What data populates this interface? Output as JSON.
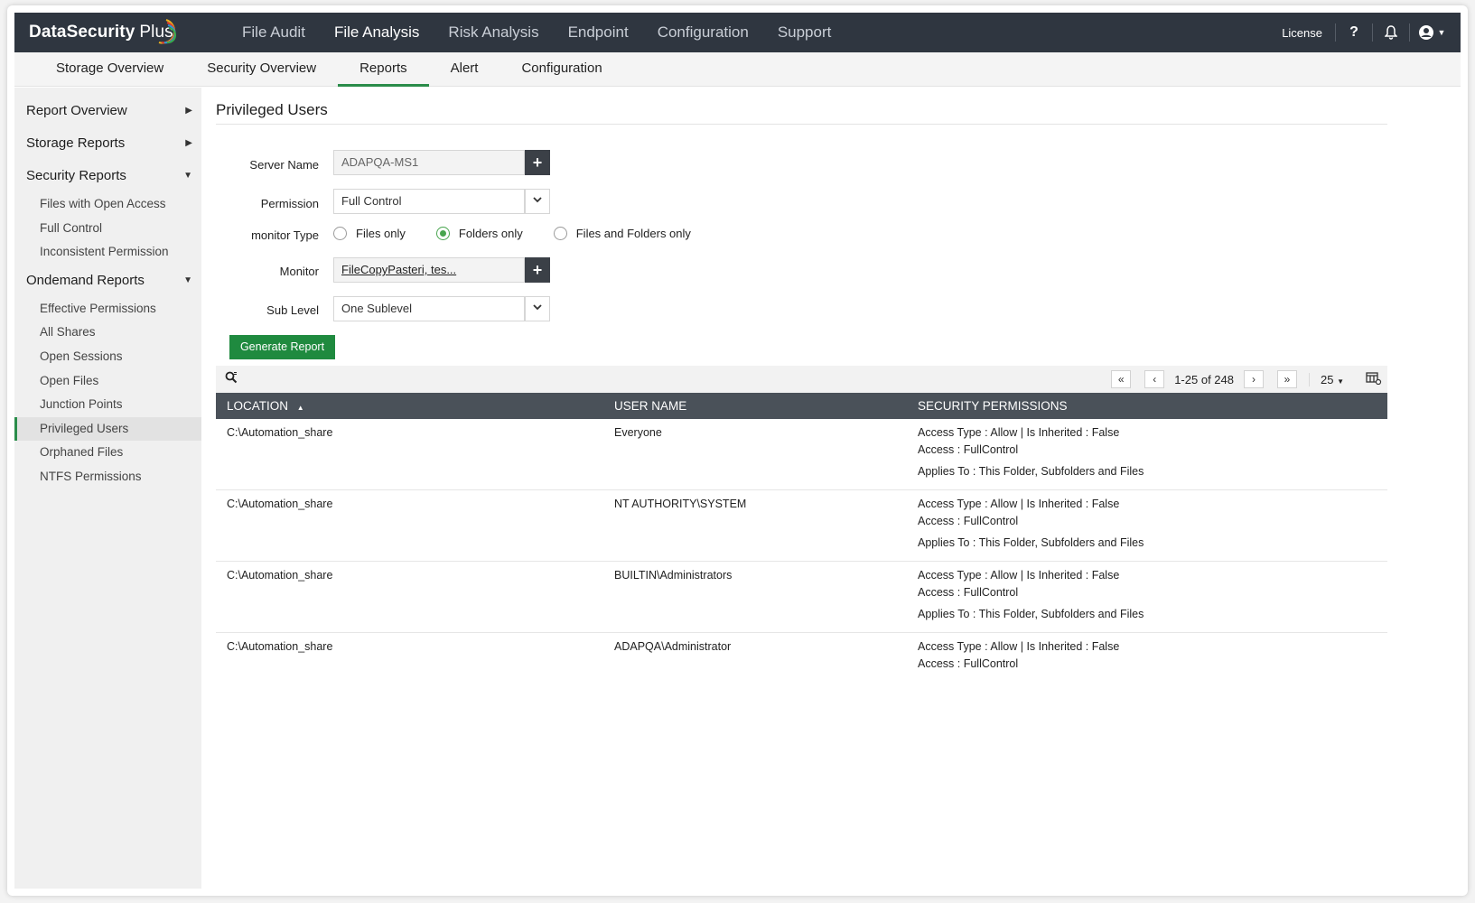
{
  "app": {
    "brand": "DataSecurity",
    "brand_plus": "Plus"
  },
  "topnav": [
    "File Audit",
    "File Analysis",
    "Risk Analysis",
    "Endpoint",
    "Configuration",
    "Support"
  ],
  "topnav_active": "File Analysis",
  "topright": {
    "license": "License",
    "help": "?"
  },
  "subnav": [
    "Storage Overview",
    "Security Overview",
    "Reports",
    "Alert",
    "Configuration"
  ],
  "subnav_active": "Reports",
  "sidebar": {
    "groups": [
      {
        "label": "Report Overview",
        "expanded": false,
        "items": []
      },
      {
        "label": "Storage Reports",
        "expanded": false,
        "items": []
      },
      {
        "label": "Security Reports",
        "expanded": true,
        "items": [
          "Files with Open Access",
          "Full Control",
          "Inconsistent Permission"
        ]
      },
      {
        "label": "Ondemand Reports",
        "expanded": true,
        "items": [
          "Effective Permissions",
          "All Shares",
          "Open Sessions",
          "Open Files",
          "Junction Points",
          "Privileged Users",
          "Orphaned Files",
          "NTFS Permissions"
        ]
      }
    ],
    "active_item": "Privileged Users"
  },
  "page": {
    "title": "Privileged Users"
  },
  "form": {
    "server_label": "Server Name",
    "server_value": "ADAPQA-MS1",
    "permission_label": "Permission",
    "permission_value": "Full Control",
    "monitor_type_label": "monitor Type",
    "monitor_type_options": [
      "Files only",
      "Folders only",
      "Files and Folders only"
    ],
    "monitor_type_selected": "Folders only",
    "monitor_label": "Monitor",
    "monitor_value": "FileCopyPasteri, tes...",
    "sublevel_label": "Sub Level",
    "sublevel_value": "One Sublevel",
    "generate_label": "Generate Report"
  },
  "pager": {
    "info": "1-25 of 248",
    "page_size": "25"
  },
  "table": {
    "columns": [
      "LOCATION",
      "USER NAME",
      "SECURITY PERMISSIONS"
    ],
    "sort_column": "LOCATION",
    "perm_labels": {
      "access_type": "Access Type :",
      "allow": " Allow | Is Inherited : False",
      "access": "Access : FullControl",
      "applies": "Applies To : This Folder, Subfolders and Files"
    },
    "rows": [
      {
        "location": "C:\\Automation_share",
        "user": "Everyone",
        "show_applies": true
      },
      {
        "location": "C:\\Automation_share",
        "user": "NT AUTHORITY\\SYSTEM",
        "show_applies": true
      },
      {
        "location": "C:\\Automation_share",
        "user": "BUILTIN\\Administrators",
        "show_applies": true
      },
      {
        "location": "C:\\Automation_share",
        "user": "ADAPQA\\Administrator",
        "show_applies": false
      }
    ]
  },
  "colors": {
    "topbar": "#2f3640",
    "accent_green": "#1f8a3f",
    "header_grey": "#4a5159"
  }
}
